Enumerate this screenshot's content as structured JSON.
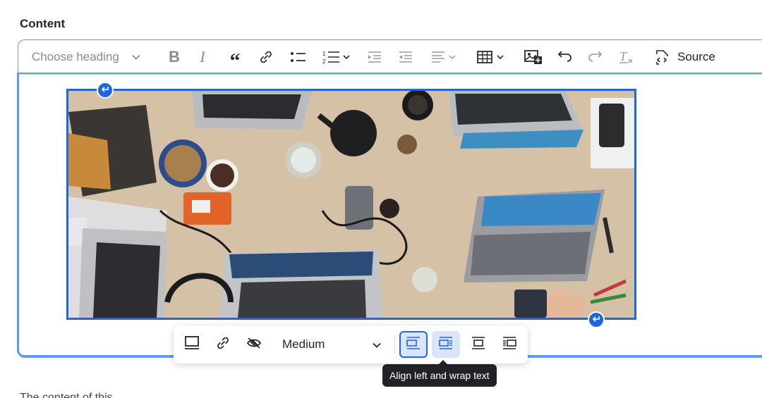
{
  "field": {
    "label": "Content"
  },
  "toolbar": {
    "heading_placeholder": "Choose heading",
    "source_label": "Source",
    "items": [
      "heading-dropdown",
      "bold",
      "italic",
      "blockquote",
      "link",
      "bulleted-list",
      "numbered-list",
      "outdent",
      "indent",
      "alignment",
      "table",
      "insert-image",
      "undo",
      "redo",
      "remove-format",
      "source"
    ]
  },
  "image_toolbar": {
    "size_value": "Medium",
    "active_alignment": "align-left-wrap",
    "tooltip": "Align left and wrap text"
  },
  "body_text_fragment": "The content of this",
  "colors": {
    "accent": "#1f66e0",
    "focus_border": "#5b9cef",
    "active_bg": "#d9e6fa",
    "tooltip_bg": "#222226"
  },
  "icons": [
    "bold-icon",
    "italic-icon",
    "quote-icon",
    "link-icon",
    "bullet-list-icon",
    "numbered-list-icon",
    "outdent-icon",
    "indent-icon",
    "align-icon",
    "table-icon",
    "image-icon",
    "undo-icon",
    "redo-icon",
    "remove-format-icon",
    "source-icon",
    "monitor-icon",
    "unlink-icon",
    "hide-icon",
    "enter-icon"
  ]
}
